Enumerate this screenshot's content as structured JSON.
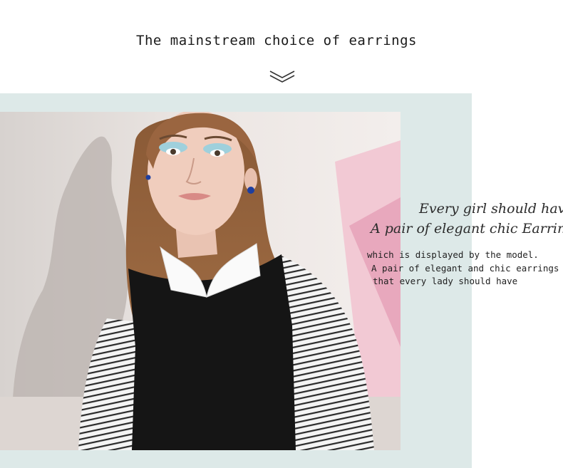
{
  "heading": "The mainstream choice of earrings",
  "icons": {
    "scroll": "double-chevron-down-icon"
  },
  "tagline": {
    "line1": "Every girl should have",
    "line2": "A pair of elegant chic Earring"
  },
  "description": [
    "which is displayed by the model.",
    "A pair of elegant and chic earrings",
    "that every lady should have"
  ],
  "colors": {
    "panel": "#dde9e8",
    "text": "#1a1a1a",
    "earring": "#1e3fa0"
  }
}
